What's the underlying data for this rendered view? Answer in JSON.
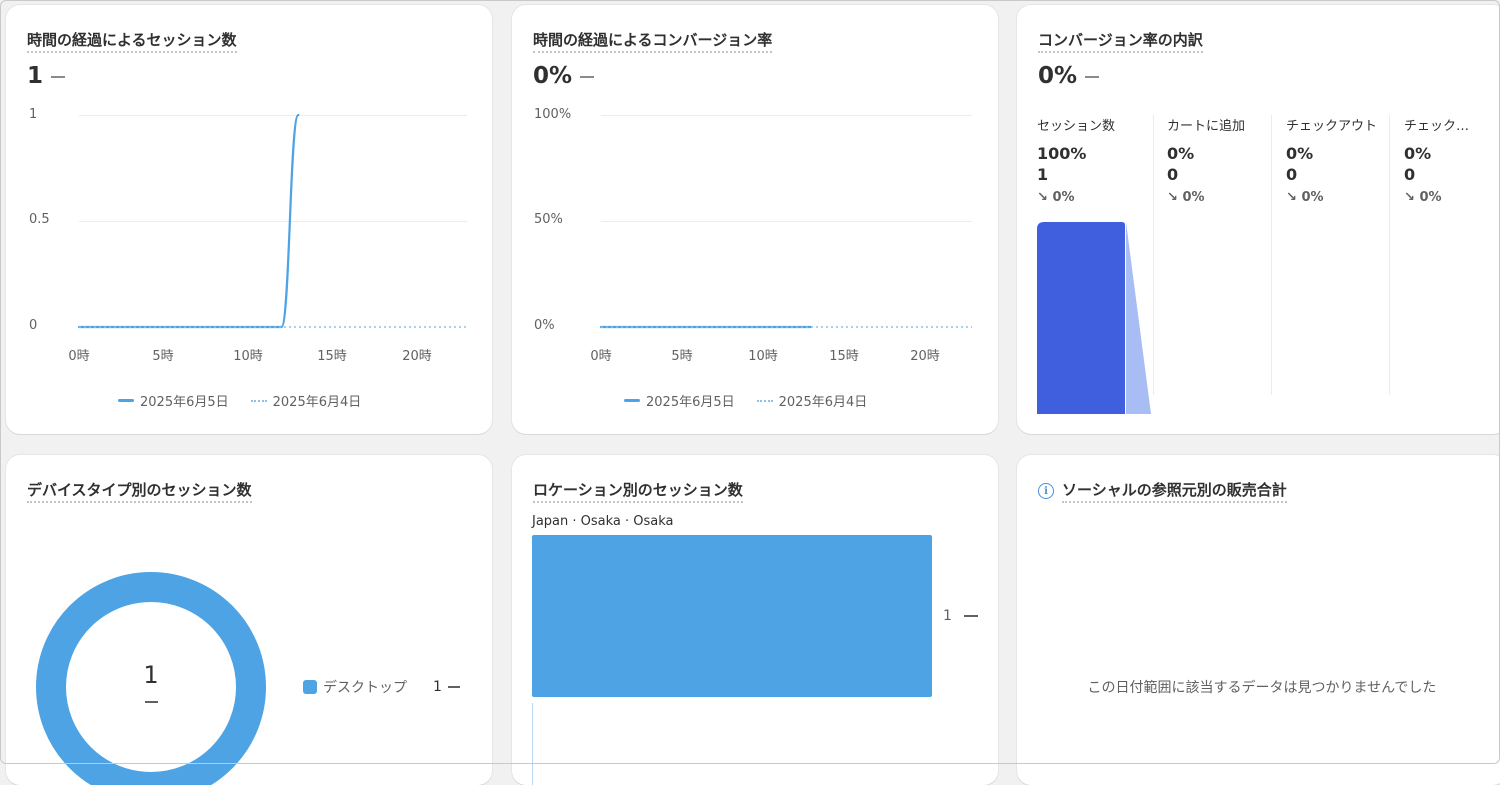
{
  "colors": {
    "series": "#4ea3e4",
    "funnel_bar": "#3f5fdf",
    "funnel_fade": "#a9bdf5"
  },
  "cards": {
    "sessions_over_time": {
      "title": "時間の経過によるセッション数",
      "value": "1",
      "yticks": [
        "1",
        "0.5",
        "0"
      ],
      "xticks": [
        "0時",
        "5時",
        "10時",
        "15時",
        "20時"
      ],
      "legend": [
        "2025年6月5日",
        "2025年6月4日"
      ]
    },
    "conversion_over_time": {
      "title": "時間の経過によるコンバージョン率",
      "value": "0%",
      "yticks": [
        "100%",
        "50%",
        "0%"
      ],
      "xticks": [
        "0時",
        "5時",
        "10時",
        "15時",
        "20時"
      ],
      "legend": [
        "2025年6月5日",
        "2025年6月4日"
      ]
    },
    "conversion_breakdown": {
      "title": "コンバージョン率の内訳",
      "value": "0%",
      "steps": [
        {
          "label": "セッション数",
          "pct": "100%",
          "count": "1",
          "change": "0%"
        },
        {
          "label": "カートに追加",
          "pct": "0%",
          "count": "0",
          "change": "0%"
        },
        {
          "label": "チェックアウト",
          "pct": "0%",
          "count": "0",
          "change": "0%"
        },
        {
          "label": "チェックアウト完了",
          "pct": "0%",
          "count": "0",
          "change": "0%"
        }
      ]
    },
    "device_sessions": {
      "title": "デバイスタイプ別のセッション数",
      "center_value": "1",
      "legend_label": "デスクトップ",
      "legend_value": "1"
    },
    "location_sessions": {
      "title": "ロケーション別のセッション数",
      "bar_label": "Japan · Osaka · Osaka",
      "bar_value": "1"
    },
    "social_referrer": {
      "title": "ソーシャルの参照元別の販売合計",
      "empty_message": "この日付範囲に該当するデータは見つかりませんでした"
    }
  },
  "chart_data": [
    {
      "type": "line",
      "title": "時間の経過によるセッション数",
      "x": [
        0,
        1,
        2,
        3,
        4,
        5,
        6,
        7,
        8,
        9,
        10,
        11,
        12,
        13,
        14,
        15,
        16,
        17,
        18,
        19,
        20,
        21,
        22,
        23
      ],
      "xticks": [
        "0時",
        "5時",
        "10時",
        "15時",
        "20時"
      ],
      "ylim": [
        0,
        1
      ],
      "series": [
        {
          "name": "2025年6月5日",
          "style": "solid",
          "values": [
            0,
            0,
            0,
            0,
            0,
            0,
            0,
            0,
            0,
            0,
            0,
            0,
            0,
            1
          ]
        },
        {
          "name": "2025年6月4日",
          "style": "dotted",
          "values": [
            0,
            0,
            0,
            0,
            0,
            0,
            0,
            0,
            0,
            0,
            0,
            0,
            0,
            0,
            0,
            0,
            0,
            0,
            0,
            0,
            0,
            0,
            0,
            0
          ]
        }
      ]
    },
    {
      "type": "line",
      "title": "時間の経過によるコンバージョン率",
      "x": [
        0,
        1,
        2,
        3,
        4,
        5,
        6,
        7,
        8,
        9,
        10,
        11,
        12,
        13,
        14,
        15,
        16,
        17,
        18,
        19,
        20,
        21,
        22,
        23
      ],
      "xticks": [
        "0時",
        "5時",
        "10時",
        "15時",
        "20時"
      ],
      "ylim": [
        0,
        100
      ],
      "series": [
        {
          "name": "2025年6月5日",
          "style": "solid",
          "values": [
            0,
            0,
            0,
            0,
            0,
            0,
            0,
            0,
            0,
            0,
            0,
            0,
            0,
            0
          ]
        },
        {
          "name": "2025年6月4日",
          "style": "dotted",
          "values": [
            0,
            0,
            0,
            0,
            0,
            0,
            0,
            0,
            0,
            0,
            0,
            0,
            0,
            0,
            0,
            0,
            0,
            0,
            0,
            0,
            0,
            0,
            0,
            0
          ]
        }
      ]
    },
    {
      "type": "bar",
      "title": "コンバージョン率の内訳",
      "categories": [
        "セッション数",
        "カートに追加",
        "チェックアウト",
        "チェックアウト完了"
      ],
      "values": [
        100,
        0,
        0,
        0
      ]
    },
    {
      "type": "pie",
      "title": "デバイスタイプ別のセッション数",
      "categories": [
        "デスクトップ"
      ],
      "values": [
        1
      ]
    },
    {
      "type": "bar",
      "title": "ロケーション別のセッション数",
      "categories": [
        "Japan · Osaka · Osaka"
      ],
      "values": [
        1
      ]
    }
  ]
}
